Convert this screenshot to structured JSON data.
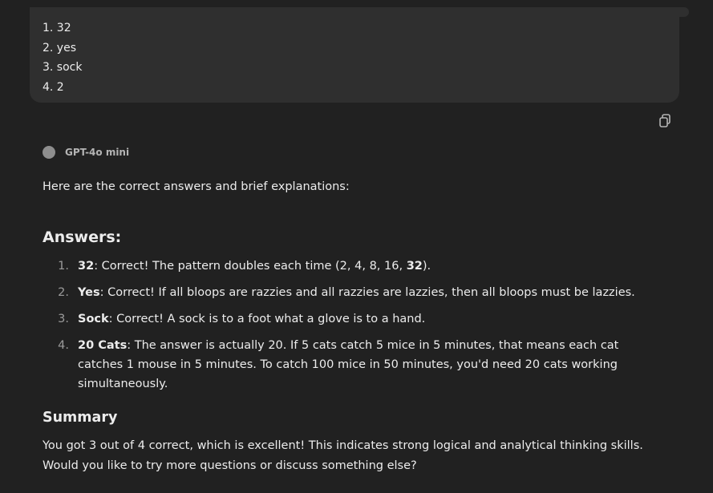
{
  "user_message": {
    "lines": [
      "1. 32",
      "2. yes",
      "3. sock",
      "4. 2"
    ]
  },
  "copy_button": {
    "icon": "copy-icon"
  },
  "assistant": {
    "model_name": "GPT-4o mini",
    "intro": "Here are the correct answers and brief explanations:",
    "answers_heading": "Answers:",
    "answers": [
      {
        "number": "1.",
        "bold": "32",
        "text_before_inline": ": Correct! The pattern doubles each time (2, 4, 8, 16, ",
        "inline_bold": "32",
        "text_after_inline": ")."
      },
      {
        "number": "2.",
        "bold": "Yes",
        "text": ": Correct! If all bloops are razzies and all razzies are lazzies, then all bloops must be lazzies."
      },
      {
        "number": "3.",
        "bold": "Sock",
        "text": ": Correct! A sock is to a foot what a glove is to a hand."
      },
      {
        "number": "4.",
        "bold": "20 Cats",
        "text": ": The answer is actually 20. If 5 cats catch 5 mice in 5 minutes, that means each cat catches 1 mouse in 5 minutes. To catch 100 mice in 50 minutes, you'd need 20 cats working simultaneously."
      }
    ],
    "summary_heading": "Summary",
    "summary": "You got 3 out of 4 correct, which is excellent! This indicates strong logical and analytical thinking skills. Would you like to try more questions or discuss something else?"
  },
  "colors": {
    "background": "#212121",
    "bubble": "#2f2f2f",
    "text": "#ececec",
    "muted": "#9b9b9b"
  }
}
